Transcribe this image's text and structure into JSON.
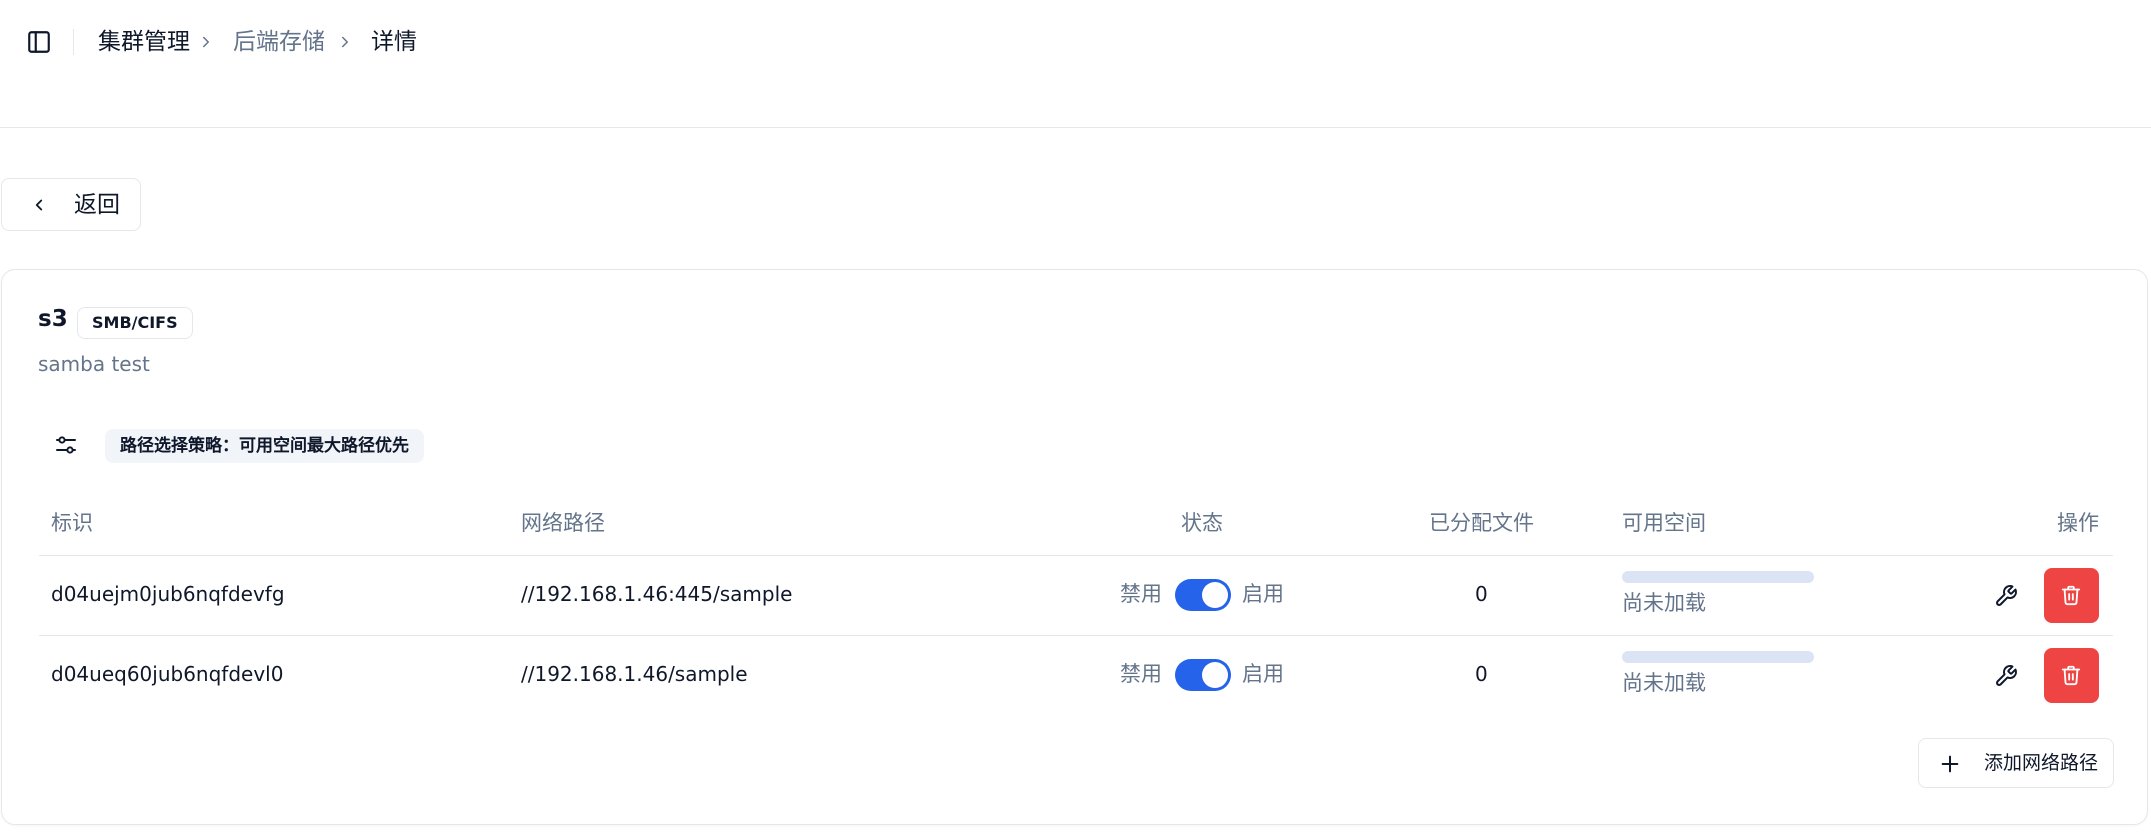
{
  "breadcrumb": [
    "集群管理",
    "后端存储",
    "详情"
  ],
  "back_label": "返回",
  "storage": {
    "name": "s3",
    "protocol": "SMB/CIFS",
    "description": "samba test",
    "strategy_label": "路径选择策略：可用空间最大路径优先"
  },
  "table": {
    "headers": [
      "标识",
      "网络路径",
      "状态",
      "已分配文件",
      "可用空间",
      "操作"
    ],
    "rows": [
      {
        "id": "d04uejm0jub6nqfdevfg",
        "path": "//192.168.1.46:445/sample",
        "disabled_label": "禁用",
        "enabled_label": "启用",
        "enabled": true,
        "allocated": "0",
        "space_status": "尚未加载",
        "space_fraction": 0
      },
      {
        "id": "d04ueq60jub6nqfdevl0",
        "path": "//192.168.1.46/sample",
        "disabled_label": "禁用",
        "enabled_label": "启用",
        "enabled": true,
        "allocated": "0",
        "space_status": "尚未加载",
        "space_fraction": 0
      }
    ]
  },
  "add_path_label": "添加网络路径",
  "colors": {
    "primary": "#2563eb",
    "danger": "#ef4444",
    "muted": "#64748b",
    "border": "#e5e7eb"
  },
  "icons": [
    "sidebar-toggle-icon",
    "chevron-right-icon",
    "chevron-left-icon",
    "sliders-icon",
    "wrench-icon",
    "trash-icon",
    "plus-icon"
  ]
}
